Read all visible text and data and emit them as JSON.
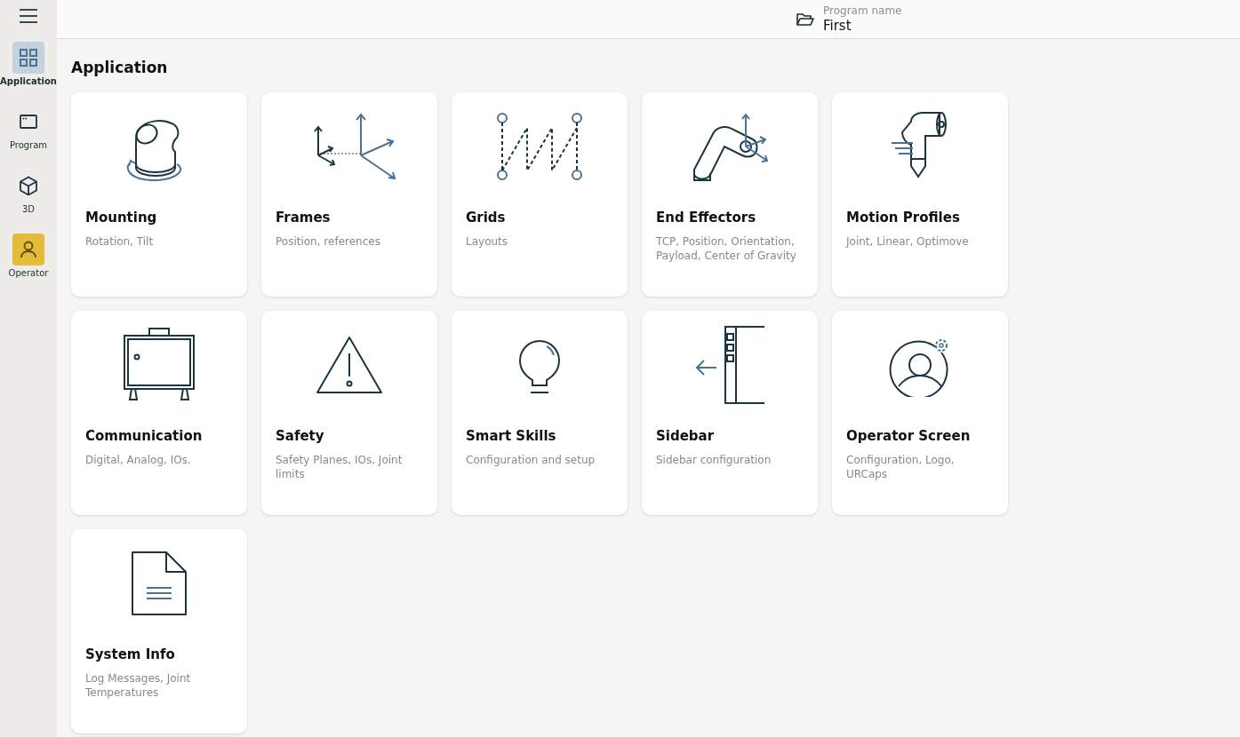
{
  "sidebar": {
    "items": [
      {
        "label": "Application",
        "selected": true,
        "kind": "nav"
      },
      {
        "label": "Program",
        "selected": false,
        "kind": "nav"
      },
      {
        "label": "3D",
        "selected": false,
        "kind": "nav"
      },
      {
        "label": "Operator",
        "selected": false,
        "kind": "operator"
      }
    ]
  },
  "header": {
    "program_label": "Program name",
    "program_name": "First"
  },
  "page_title": "Application",
  "cards": [
    {
      "title": "Mounting",
      "subtitle": "Rotation, Tilt"
    },
    {
      "title": "Frames",
      "subtitle": "Position, references"
    },
    {
      "title": "Grids",
      "subtitle": "Layouts"
    },
    {
      "title": "End Effectors",
      "subtitle": "TCP, Position, Orientation, Payload, Center of Gravity"
    },
    {
      "title": "Motion Profiles",
      "subtitle": "Joint, Linear, Optimove"
    },
    {
      "title": "Communication",
      "subtitle": "Digital, Analog, IOs."
    },
    {
      "title": "Safety",
      "subtitle": "Safety Planes, IOs, Joint limits"
    },
    {
      "title": "Smart Skills",
      "subtitle": "Configuration and setup"
    },
    {
      "title": "Sidebar",
      "subtitle": "Sidebar configuration"
    },
    {
      "title": "Operator Screen",
      "subtitle": "Configuration, Logo, URCaps"
    },
    {
      "title": "System Info",
      "subtitle": "Log Messages, Joint Temperatures"
    }
  ]
}
